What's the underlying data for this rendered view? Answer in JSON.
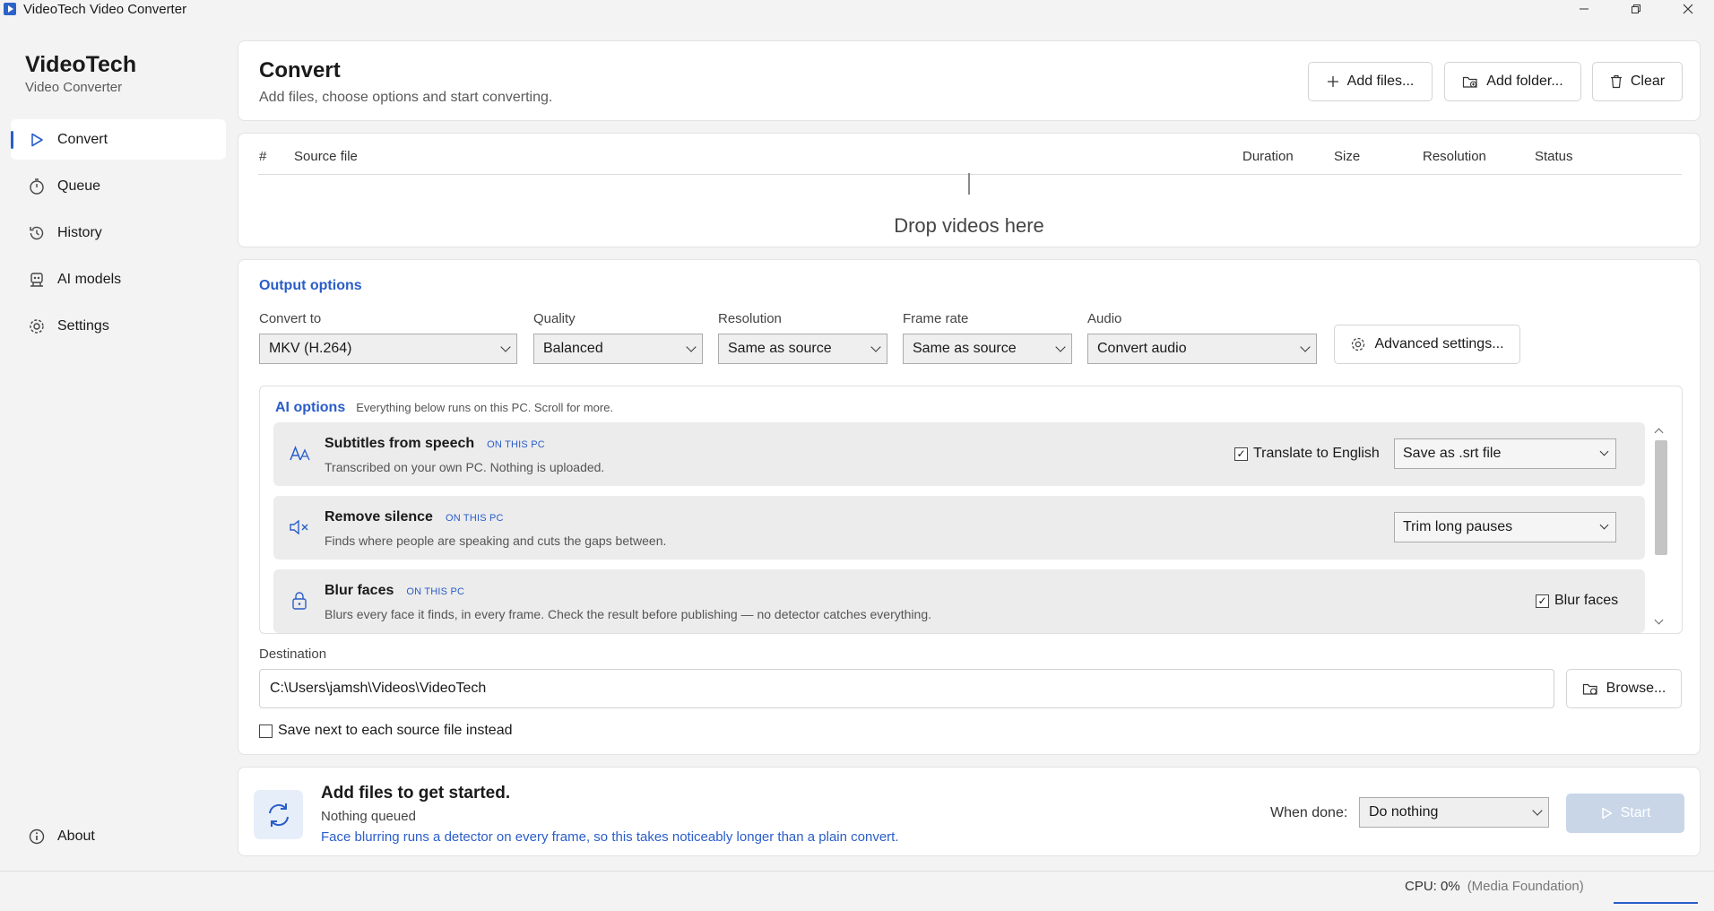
{
  "window": {
    "title": "VideoTech Video Converter"
  },
  "brand": {
    "name": "VideoTech",
    "subtitle": "Video Converter"
  },
  "sidebar": {
    "items": [
      {
        "label": "Convert",
        "icon": "play-icon",
        "active": true
      },
      {
        "label": "Queue",
        "icon": "timer-icon"
      },
      {
        "label": "History",
        "icon": "history-icon"
      },
      {
        "label": "AI models",
        "icon": "robot-icon"
      },
      {
        "label": "Settings",
        "icon": "gear-icon"
      }
    ],
    "about": "About"
  },
  "header": {
    "title": "Convert",
    "description": "Add files, choose options and start converting.",
    "add_files": "Add files...",
    "add_folder": "Add folder...",
    "clear": "Clear"
  },
  "files": {
    "columns": {
      "index": "#",
      "source": "Source file",
      "duration": "Duration",
      "size": "Size",
      "resolution": "Resolution",
      "status": "Status"
    },
    "drop_text": "Drop videos here"
  },
  "output": {
    "title": "Output options",
    "convert_to": {
      "label": "Convert to",
      "value": "MKV (H.264)"
    },
    "quality": {
      "label": "Quality",
      "value": "Balanced"
    },
    "resolution": {
      "label": "Resolution",
      "value": "Same as source"
    },
    "frame_rate": {
      "label": "Frame rate",
      "value": "Same as source"
    },
    "audio": {
      "label": "Audio",
      "value": "Convert audio"
    },
    "advanced": "Advanced settings..."
  },
  "ai": {
    "title": "AI options",
    "subtitle": "Everything below runs on this PC. Scroll for more.",
    "badge": "ON THIS PC",
    "cards": [
      {
        "name": "Subtitles from speech",
        "desc": "Transcribed on your own PC. Nothing is uploaded.",
        "checkbox": "Translate to English",
        "checked": true,
        "select": "Save as .srt file"
      },
      {
        "name": "Remove silence",
        "desc": "Finds where people are speaking and cuts the gaps between.",
        "select": "Trim long pauses"
      },
      {
        "name": "Blur faces",
        "desc": "Blurs every face it finds, in every frame. Check the result before publishing — no detector catches everything.",
        "checkbox": "Blur faces",
        "checked": true
      }
    ]
  },
  "destination": {
    "label": "Destination",
    "path": "C:\\Users\\jamsh\\Videos\\VideoTech",
    "browse": "Browse...",
    "save_next": "Save next to each source file instead"
  },
  "status": {
    "title": "Add files to get started.",
    "sub": "Nothing queued",
    "note": "Face blurring runs a detector on every frame, so this takes noticeably longer than a plain convert.",
    "when_done_label": "When done:",
    "when_done_value": "Do nothing",
    "start": "Start"
  },
  "statusbar": {
    "cpu": "CPU: 0%",
    "engine": "(Media Foundation)"
  },
  "colors": {
    "accent": "#2a5dc9",
    "start_disabled": "#c9d6e8"
  }
}
